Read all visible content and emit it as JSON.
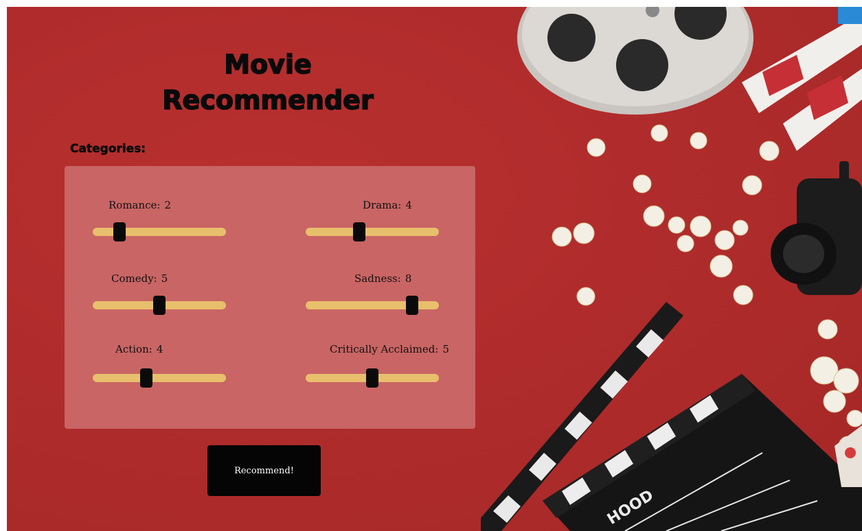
{
  "app": {
    "title_line1": "Movie",
    "title_line2": "Recommender"
  },
  "categories_label": "Categories:",
  "sliders": [
    {
      "label": "Romance:",
      "value": 2,
      "fraction": 0.2
    },
    {
      "label": "Drama:",
      "value": 4,
      "fraction": 0.4
    },
    {
      "label": "Comedy:",
      "value": 5,
      "fraction": 0.5
    },
    {
      "label": "Sadness:",
      "value": 8,
      "fraction": 0.8
    },
    {
      "label": "Action:",
      "value": 4,
      "fraction": 0.4
    },
    {
      "label": "Critically Acclaimed:",
      "value": 5,
      "fraction": 0.5
    }
  ],
  "button": {
    "label": "Recommend!"
  },
  "clapperboard_text": "HOOD",
  "colors": {
    "background": "#b02c2c",
    "panel": "#c96564",
    "track": "#e8bf6c",
    "thumb": "#0a0a0a",
    "button": "#050505"
  }
}
